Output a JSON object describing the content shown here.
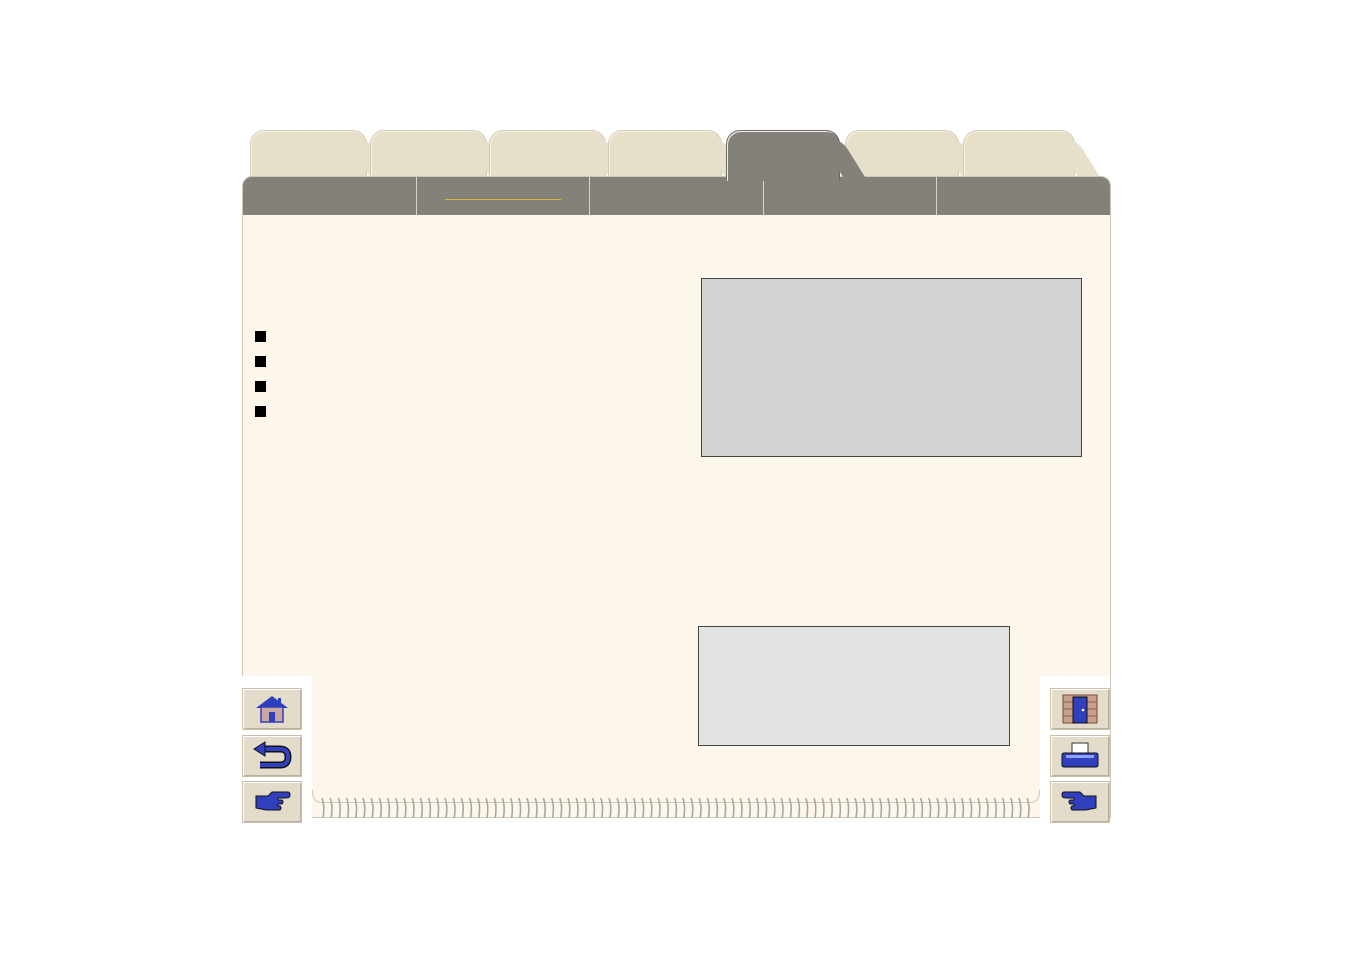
{
  "tabs": [
    {
      "label": ""
    },
    {
      "label": ""
    },
    {
      "label": ""
    },
    {
      "label": ""
    },
    {
      "label": "",
      "active": true
    },
    {
      "label": ""
    },
    {
      "label": ""
    }
  ],
  "subnav": [
    {
      "label": ""
    },
    {
      "label": "",
      "active": true
    },
    {
      "label": ""
    },
    {
      "label": ""
    },
    {
      "label": ""
    }
  ],
  "bullets": [
    {
      "text": ""
    },
    {
      "text": ""
    },
    {
      "text": ""
    },
    {
      "text": ""
    }
  ],
  "nav_buttons": {
    "left": [
      "home-icon",
      "back-icon",
      "next-page-icon"
    ],
    "right": [
      "exit-door-icon",
      "printer-icon",
      "previous-page-icon"
    ]
  },
  "colors": {
    "tab_inactive": "#e6e0cb",
    "tab_active": "#84817a",
    "page_background": "#fdf6eb",
    "icon_blue": "#2f3fbd"
  }
}
